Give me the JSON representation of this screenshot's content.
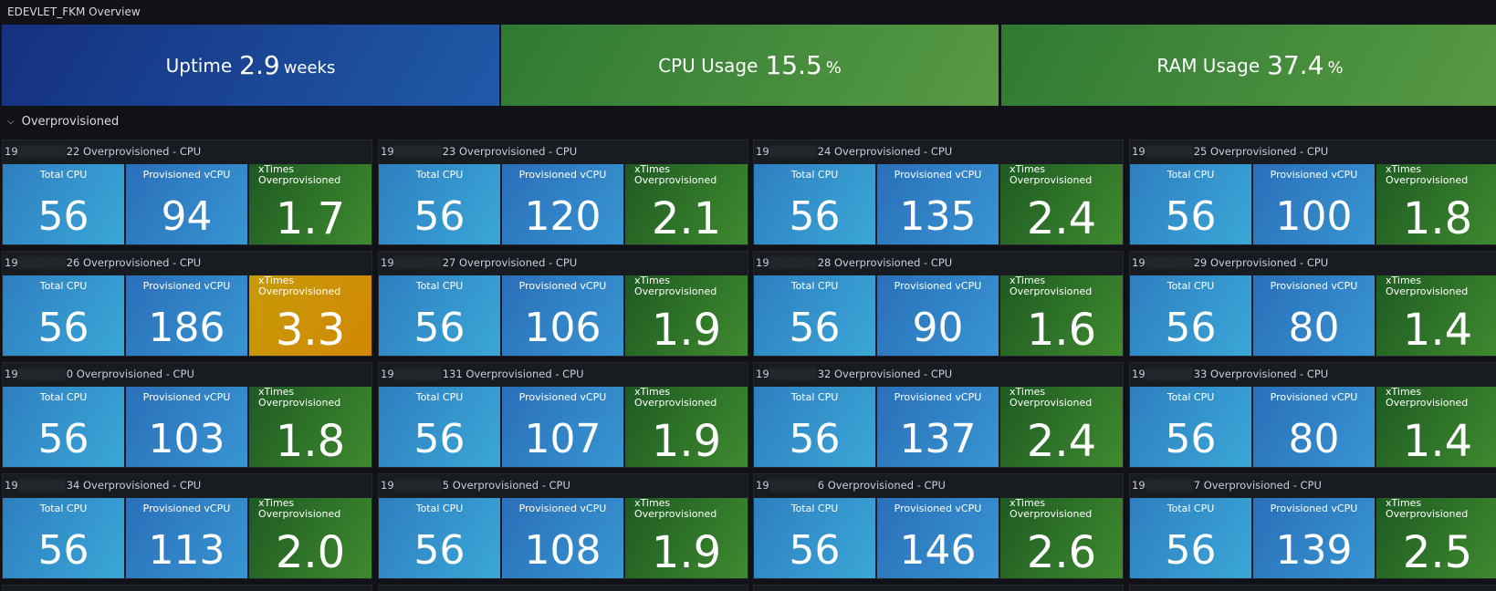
{
  "dashboard": {
    "title": "EDEVLET_FKM Overview"
  },
  "top_stats": [
    {
      "label": "Uptime",
      "value": "2.9",
      "unit": "weeks"
    },
    {
      "label": "CPU Usage",
      "value": "15.5",
      "unit": "%"
    },
    {
      "label": "RAM Usage",
      "value": "37.4",
      "unit": "%"
    }
  ],
  "row": {
    "title": "Overprovisioned",
    "icon": "chevron-down-icon"
  },
  "labels": {
    "total": "Total CPU",
    "prov": "Provisioned vCPU",
    "x": "xTimes Overprovisioned"
  },
  "panels": [
    {
      "prefix": "19",
      "suffix": "22 Overprovisioned - CPU",
      "total": "56",
      "prov": "94",
      "x": "1.7",
      "x_color": "green"
    },
    {
      "prefix": "19",
      "suffix": "23 Overprovisioned - CPU",
      "total": "56",
      "prov": "120",
      "x": "2.1",
      "x_color": "green"
    },
    {
      "prefix": "19",
      "suffix": "24 Overprovisioned - CPU",
      "total": "56",
      "prov": "135",
      "x": "2.4",
      "x_color": "green"
    },
    {
      "prefix": "19",
      "suffix": "25 Overprovisioned - CPU",
      "total": "56",
      "prov": "100",
      "x": "1.8",
      "x_color": "green"
    },
    {
      "prefix": "19",
      "suffix": "26 Overprovisioned - CPU",
      "total": "56",
      "prov": "186",
      "x": "3.3",
      "x_color": "orange"
    },
    {
      "prefix": "19",
      "suffix": "27 Overprovisioned - CPU",
      "total": "56",
      "prov": "106",
      "x": "1.9",
      "x_color": "green"
    },
    {
      "prefix": "19",
      "suffix": "28 Overprovisioned - CPU",
      "total": "56",
      "prov": "90",
      "x": "1.6",
      "x_color": "green"
    },
    {
      "prefix": "19",
      "suffix": "29 Overprovisioned - CPU",
      "total": "56",
      "prov": "80",
      "x": "1.4",
      "x_color": "green"
    },
    {
      "prefix": "19",
      "suffix": "0 Overprovisioned - CPU",
      "total": "56",
      "prov": "103",
      "x": "1.8",
      "x_color": "green"
    },
    {
      "prefix": "19",
      "suffix": "131 Overprovisioned - CPU",
      "total": "56",
      "prov": "107",
      "x": "1.9",
      "x_color": "green"
    },
    {
      "prefix": "19",
      "suffix": "32 Overprovisioned - CPU",
      "total": "56",
      "prov": "137",
      "x": "2.4",
      "x_color": "green"
    },
    {
      "prefix": "19",
      "suffix": "33 Overprovisioned - CPU",
      "total": "56",
      "prov": "80",
      "x": "1.4",
      "x_color": "green"
    },
    {
      "prefix": "19",
      "suffix": "34 Overprovisioned - CPU",
      "total": "56",
      "prov": "113",
      "x": "2.0",
      "x_color": "green"
    },
    {
      "prefix": "19",
      "suffix": "5 Overprovisioned - CPU",
      "total": "56",
      "prov": "108",
      "x": "1.9",
      "x_color": "green"
    },
    {
      "prefix": "19",
      "suffix": "6 Overprovisioned - CPU",
      "total": "56",
      "prov": "146",
      "x": "2.6",
      "x_color": "green"
    },
    {
      "prefix": "19",
      "suffix": "7 Overprovisioned - CPU",
      "total": "56",
      "prov": "139",
      "x": "2.5",
      "x_color": "green"
    }
  ]
}
